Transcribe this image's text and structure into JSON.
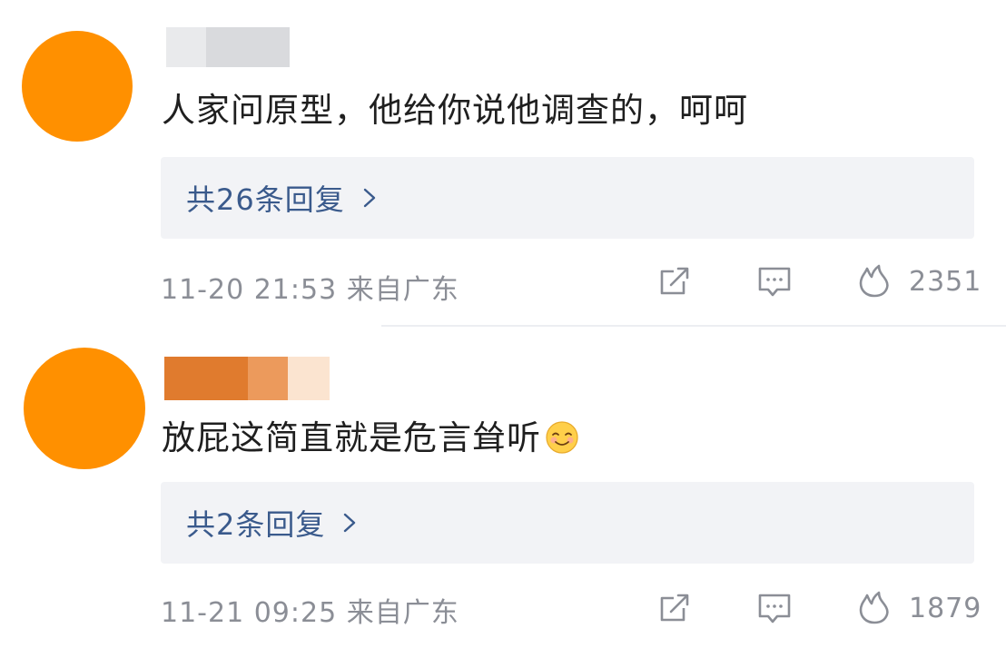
{
  "colors": {
    "avatar": "#ff9000",
    "reply_link": "#3a5a8c",
    "meta_text": "#8b8e96",
    "reply_box_bg": "#f2f3f6"
  },
  "comments": [
    {
      "text": "人家问原型，他给你说他调查的，呵呵",
      "replies_label": "共26条回复",
      "timestamp": "11-20 21:53",
      "location": "来自广东",
      "likes": "2351",
      "icons": [
        "share-icon",
        "comment-icon",
        "like-icon",
        "chevron-right-icon"
      ]
    },
    {
      "text": "放屁这简直就是危言耸听",
      "emoji": "smiling-face-emoji",
      "replies_label": "共2条回复",
      "timestamp": "11-21 09:25",
      "location": "来自广东",
      "likes": "1879",
      "icons": [
        "share-icon",
        "comment-icon",
        "like-icon",
        "chevron-right-icon"
      ]
    }
  ]
}
